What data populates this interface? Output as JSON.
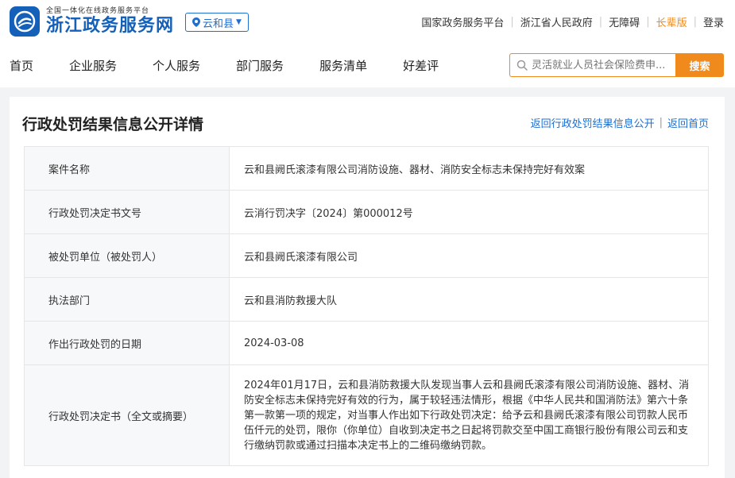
{
  "header": {
    "logo_subtitle": "全国一体化在线政务服务平台",
    "logo_title": "浙江政务服务网",
    "region": "云和县",
    "top_links": [
      "国家政务服务平台",
      "浙江省人民政府",
      "无障碍",
      "长辈版",
      "登录"
    ]
  },
  "nav": {
    "items": [
      "首页",
      "企业服务",
      "个人服务",
      "部门服务",
      "服务清单",
      "好差评"
    ]
  },
  "search": {
    "placeholder": "灵活就业人员社会保险费申...",
    "button": "搜索"
  },
  "page": {
    "title": "行政处罚结果信息公开详情",
    "return_list": "返回行政处罚结果信息公开",
    "return_home": "返回首页"
  },
  "details": [
    {
      "label": "案件名称",
      "value": "云和县阙氏滚漆有限公司消防设施、器材、消防安全标志未保持完好有效案"
    },
    {
      "label": "行政处罚决定书文号",
      "value": "云消行罚决字〔2024〕第000012号"
    },
    {
      "label": "被处罚单位（被处罚人）",
      "value": "云和县阙氏滚漆有限公司"
    },
    {
      "label": "执法部门",
      "value": "云和县消防救援大队"
    },
    {
      "label": "作出行政处罚的日期",
      "value": "2024-03-08"
    },
    {
      "label": "行政处罚决定书（全文或摘要）",
      "value": "2024年01月17日，云和县消防救援大队发现当事人云和县阙氏滚漆有限公司消防设施、器材、消防安全标志未保持完好有效的行为，属于较轻违法情形，根据《中华人民共和国消防法》第六十条第一款第一项的规定，对当事人作出如下行政处罚决定：给予云和县阙氏滚漆有限公司罚款人民币伍仟元的处罚，限你（你单位）自收到决定书之日起将罚款交至中国工商银行股份有限公司云和支行缴纳罚款或通过扫描本决定书上的二维码缴纳罚款。"
    }
  ],
  "colors": {
    "brand_blue": "#1560b8",
    "link_blue": "#1e6fd0",
    "accent_orange": "#f08a1c"
  }
}
